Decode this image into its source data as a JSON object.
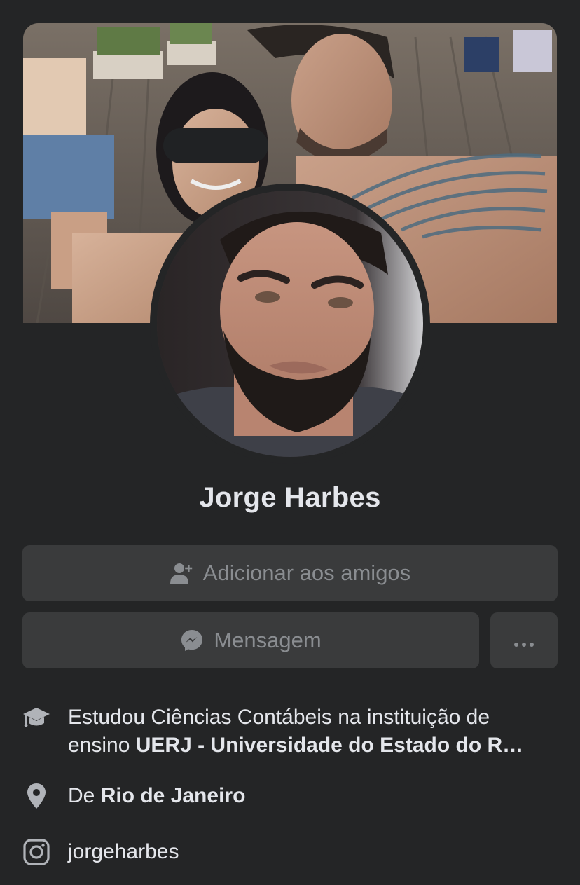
{
  "profile": {
    "name": "Jorge Harbes",
    "add_friend_label": "Adicionar aos amigos",
    "message_label": "Mensagem",
    "more_label": "···"
  },
  "info": {
    "education_prefix": "Estudou Ciências Contábeis na instituição de",
    "education_line2_prefix": "ensino ",
    "education_school": "UERJ - Universidade do Estado do R…",
    "location_prefix": "De ",
    "location_city": "Rio de Janeiro",
    "instagram_handle": "jorgeharbes"
  },
  "icons": {
    "add_friend": "person-add-icon",
    "message": "messenger-icon",
    "more": "ellipsis-icon",
    "education": "graduation-cap-icon",
    "location": "map-pin-icon",
    "instagram": "instagram-icon"
  },
  "colors": {
    "background": "#242526",
    "button": "#3a3b3c",
    "button_text": "#8a8d91",
    "text_primary": "#e4e6eb",
    "divider": "#3e4042"
  }
}
